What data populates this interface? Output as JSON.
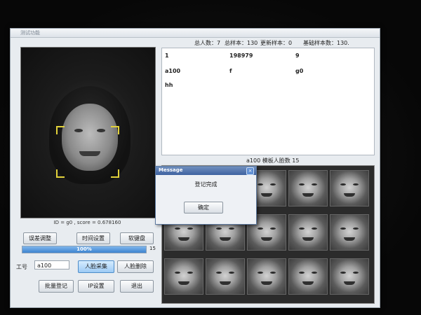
{
  "window": {
    "title": "测试功能"
  },
  "stats": {
    "total_people": "总人数：7",
    "total_samples": "总样本：130",
    "updated_samples": "更新样本：0",
    "base_samples": "基础样本数：130."
  },
  "text_list": {
    "rows": [
      [
        "1",
        "198979",
        "9"
      ],
      [
        "a100",
        "f",
        "g0"
      ],
      [
        "hh",
        "",
        ""
      ]
    ]
  },
  "template": {
    "label": "a100  模板人脸数  15"
  },
  "camera": {
    "id_score": "ID = g0 , score = 0.678160"
  },
  "progress": {
    "value": 1.0,
    "label": "100%",
    "count": "15"
  },
  "buttons": {
    "error_adjust": "误差调整",
    "time_setting": "时间设置",
    "soft_keyboard": "软键盘",
    "face_capture": "人脸采集",
    "face_delete": "人脸删除",
    "batch_register": "批量登记",
    "ip_setting": "IP设置",
    "exit": "退出"
  },
  "work_id": {
    "label": "工号",
    "value": "a100"
  },
  "dialog": {
    "title": "Message",
    "message": "登记完成",
    "ok": "确定",
    "close_icon": "close-icon"
  },
  "colors": {
    "accent": "#3d84cf",
    "face_box": "#e2d23a",
    "dialog_title": "#3f62a0"
  }
}
